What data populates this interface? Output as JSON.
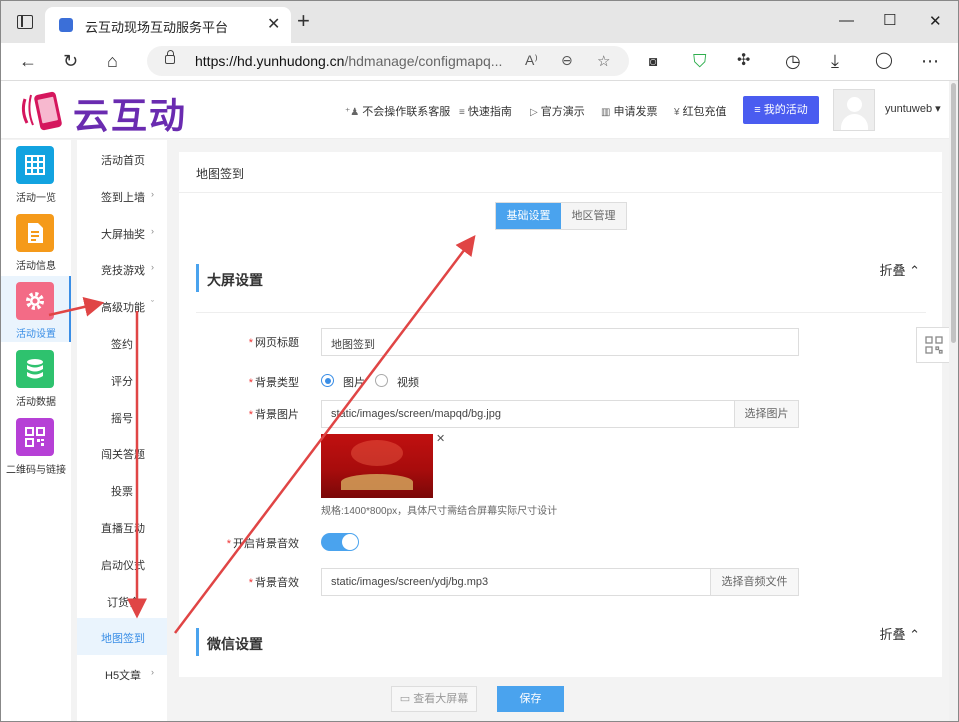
{
  "browser": {
    "tab_title": "云互动现场互动服务平台",
    "url_host": "https://hd.yunhudong.cn",
    "url_path": "/hdmanage/configmapq..."
  },
  "header": {
    "logo_text": "云互动",
    "links": [
      {
        "icon": "user-plus-icon",
        "glyph": "⁺♟",
        "label": "不会操作联系客服"
      },
      {
        "icon": "list-icon",
        "glyph": "≡",
        "label": "快速指南"
      },
      {
        "icon": "play-circle-icon",
        "glyph": "▷",
        "label": "官方演示"
      },
      {
        "icon": "invoice-icon",
        "glyph": "▥",
        "label": "申请发票"
      },
      {
        "icon": "yen-icon",
        "glyph": "¥",
        "label": "红包充值"
      }
    ],
    "my_activity": "我的活动",
    "username": "yuntuweb"
  },
  "iconbar": [
    {
      "label": "活动一览",
      "color": "#12a3e0",
      "icon": "grid-icon",
      "active": false
    },
    {
      "label": "活动信息",
      "color": "#f59a1a",
      "icon": "document-icon",
      "active": false
    },
    {
      "label": "活动设置",
      "color": "#f36b86",
      "icon": "gear-icon",
      "active": true
    },
    {
      "label": "活动数据",
      "color": "#2ec26e",
      "icon": "database-icon",
      "active": false
    },
    {
      "label": "二维码与链接",
      "color": "#b640d6",
      "icon": "qrcode-icon",
      "active": false
    }
  ],
  "submenu": [
    {
      "label": "活动首页",
      "arrow": "",
      "sub": false,
      "active": false
    },
    {
      "label": "签到上墙",
      "arrow": "›",
      "sub": false,
      "active": false
    },
    {
      "label": "大屏抽奖",
      "arrow": "›",
      "sub": false,
      "active": false
    },
    {
      "label": "竞技游戏",
      "arrow": "›",
      "sub": false,
      "active": false
    },
    {
      "label": "高级功能",
      "arrow": "ˇ",
      "sub": false,
      "active": false
    },
    {
      "label": "签约",
      "arrow": "",
      "sub": true,
      "active": false
    },
    {
      "label": "评分",
      "arrow": "",
      "sub": true,
      "active": false
    },
    {
      "label": "摇号",
      "arrow": "",
      "sub": true,
      "active": false
    },
    {
      "label": "闯关答题",
      "arrow": "",
      "sub": false,
      "active": false
    },
    {
      "label": "投票",
      "arrow": "",
      "sub": true,
      "active": false
    },
    {
      "label": "直播互动",
      "arrow": "",
      "sub": false,
      "active": false
    },
    {
      "label": "启动仪式",
      "arrow": "",
      "sub": false,
      "active": false
    },
    {
      "label": "订货会",
      "arrow": "",
      "sub": false,
      "active": false
    },
    {
      "label": "地图签到",
      "arrow": "",
      "sub": false,
      "active": true
    },
    {
      "label": "H5文章",
      "arrow": "›",
      "sub": false,
      "active": false
    }
  ],
  "content": {
    "title": "地图签到",
    "tabs": [
      "基础设置",
      "地区管理"
    ],
    "fold_label": "折叠 ⌃",
    "screen_section": "大屏设置",
    "wechat_section": "微信设置",
    "fields": {
      "page_title_label": "网页标题",
      "page_title_value": "地图签到",
      "bg_type_label": "背景类型",
      "bg_type_options": [
        "图片",
        "视频"
      ],
      "bg_image_label": "背景图片",
      "bg_image_value": "static/images/screen/mapqd/bg.jpg",
      "bg_image_button": "选择图片",
      "bg_image_hint": "规格:1400*800px，具体尺寸需结合屏幕实际尺寸设计",
      "bg_sound_toggle_label": "开启背景音效",
      "bg_sound_label": "背景音效",
      "bg_sound_value": "static/images/screen/ydj/bg.mp3",
      "bg_sound_button": "选择音频文件"
    }
  },
  "footer": {
    "bigscreen": "查看大屏幕",
    "save": "保存"
  }
}
